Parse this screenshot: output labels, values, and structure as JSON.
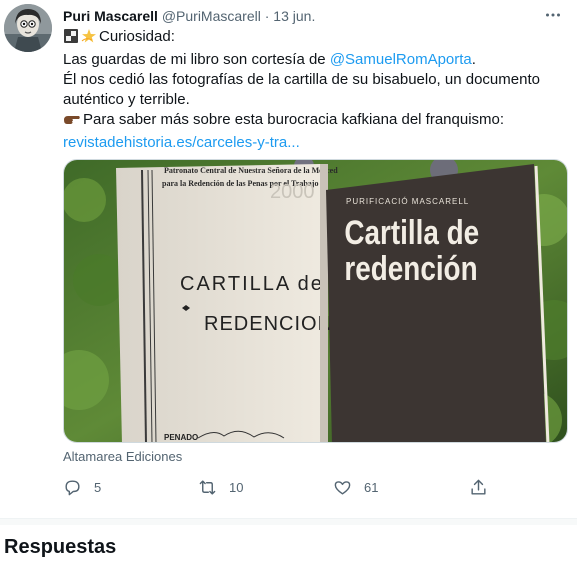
{
  "tweet": {
    "author": {
      "name": "Puri Mascarell",
      "handle": "@PuriMascarell",
      "separator": "·",
      "date": "13 jun."
    },
    "more_icon": "more-horizontal-icon",
    "text": {
      "line1": "Curiosidad:",
      "line2_pre": "Las guardas de mi libro son cortesía de ",
      "line2_mention": "@SamuelRomAporta",
      "line2_post": ".",
      "line3": "Él nos cedió las fotografías de la cartilla de su bisabuelo, un documento",
      "line4": "auténtico y terrible.",
      "line5": "Para saber más sobre esta burocracia kafkiana del franquismo:",
      "line6_link": "revistadehistoria.es/carceles-y-tra..."
    },
    "media": {
      "book_author": "PURIFICACIÓ MASCARELL",
      "book_title_1": "Cartilla de",
      "book_title_2": "redención",
      "left_header_1": "Patronato Central de Nuestra Señora de la Merced",
      "left_header_2": "para la Redención de las Penas por el Trabajo",
      "left_title_1": "CARTILLA de",
      "left_title_2": "REDENCION",
      "left_penado": "PENADO",
      "left_number": "2000"
    },
    "media_caption": "Altamarea Ediciones",
    "actions": {
      "reply_count": "5",
      "retweet_count": "10",
      "like_count": "61"
    }
  },
  "replies_heading": "Respuestas"
}
